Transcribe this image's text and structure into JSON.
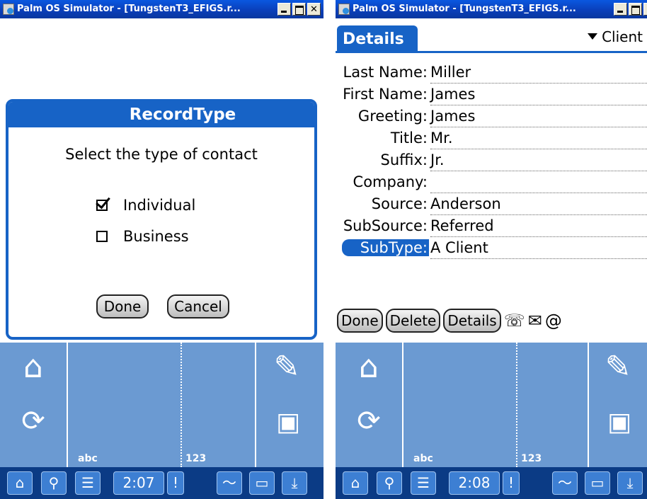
{
  "left": {
    "title": "Palm OS Simulator - [TungstenT3_EFIGS.r...",
    "dialog": {
      "title": "RecordType",
      "prompt": "Select the type of contact",
      "options": [
        {
          "label": "Individual",
          "checked": true
        },
        {
          "label": "Business",
          "checked": false
        }
      ],
      "done_label": "Done",
      "cancel_label": "Cancel"
    },
    "graffiti": {
      "abc": "abc",
      "num": "123"
    },
    "status": {
      "time": "2:07"
    }
  },
  "right": {
    "title": "Palm OS Simulator - [TungstenT3_EFIGS.r...",
    "tab": "Details",
    "category": "Client",
    "fields": [
      {
        "label": "Last Name:",
        "value": "Miller"
      },
      {
        "label": "First Name:",
        "value": "James"
      },
      {
        "label": "Greeting:",
        "value": "James"
      },
      {
        "label": "Title:",
        "value": "Mr."
      },
      {
        "label": "Suffix:",
        "value": "Jr."
      },
      {
        "label": "Company:",
        "value": ""
      },
      {
        "label": "Source:",
        "value": "Anderson"
      },
      {
        "label": "SubSource:",
        "value": "Referred"
      },
      {
        "label": "SubType:",
        "value": "A Client"
      }
    ],
    "buttons": {
      "done": "Done",
      "delete": "Delete",
      "details": "Details"
    },
    "graffiti": {
      "abc": "abc",
      "num": "123"
    },
    "status": {
      "time": "2:08"
    }
  },
  "icons": {
    "phone": "☏",
    "mail": "✉",
    "at": "@",
    "home": "⌂",
    "search": "⚲",
    "menu": "☰",
    "alert": "!",
    "pen": "✎"
  }
}
